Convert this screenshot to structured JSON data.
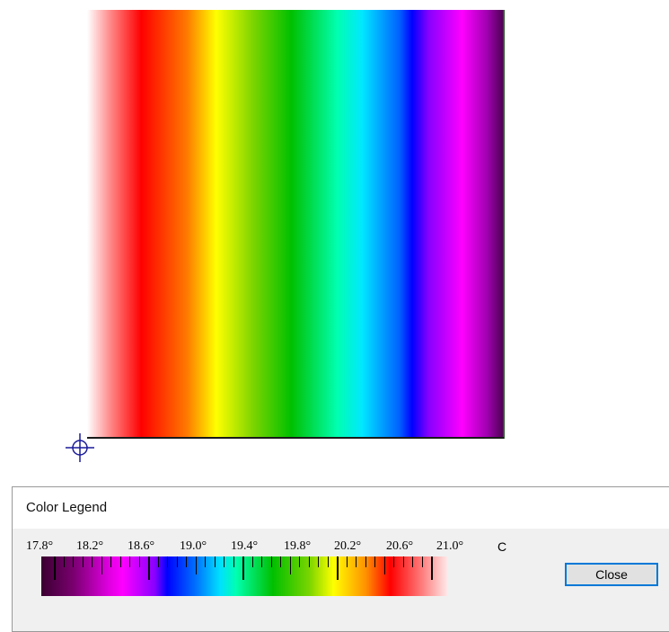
{
  "legend": {
    "title": "Color Legend",
    "ticks": [
      "17.8°",
      "18.2°",
      "18.6°",
      "19.0°",
      "19.4°",
      "19.8°",
      "20.2°",
      "20.6°",
      "21.0°"
    ],
    "unit": "C",
    "range": [
      17.8,
      21.0
    ],
    "close_label": "Close"
  },
  "colors": {
    "button_border": "#0078d7",
    "dialog_background": "#f0f0f0"
  },
  "icons": {
    "origin_marker": "crosshair-icon"
  }
}
